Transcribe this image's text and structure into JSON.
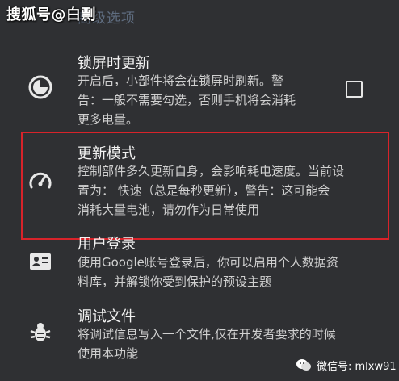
{
  "watermark_top": "搜狐号@白剽",
  "section_header": "高级选项",
  "settings": [
    {
      "title": "锁屏时更新",
      "desc_lines": [
        "开启后，小部件将会在锁屏时刷新。警",
        "告：一般不需要勾选，否则手机将会消耗",
        "更多电量。"
      ],
      "icon": "lock-clock-icon",
      "checked": false
    },
    {
      "title": "更新模式",
      "desc_lines": [
        "控制部件多久更新自身，会影响耗电速度。当前设",
        "置为： 快速（总是每秒更新），警告：这可能会",
        "消耗大量电池，请勿作为日常使用"
      ],
      "icon": "speedometer-icon"
    },
    {
      "title": "用户登录",
      "desc_lines": [
        "使用Google账号登录后，你可以启用个人数据资",
        "料库，并解锁你受到保护的预设主题"
      ],
      "icon": "account-card-icon"
    },
    {
      "title": "调试文件",
      "desc_lines": [
        "将调试信息写入一个文件,仅在开发者要求的时候",
        "使用本功能"
      ],
      "icon": "bug-icon"
    }
  ],
  "watermark_bottom": "微信号: mlxw91",
  "colors": {
    "background": "#2f3033",
    "highlight": "#d8232a",
    "header": "#5f6d80"
  }
}
